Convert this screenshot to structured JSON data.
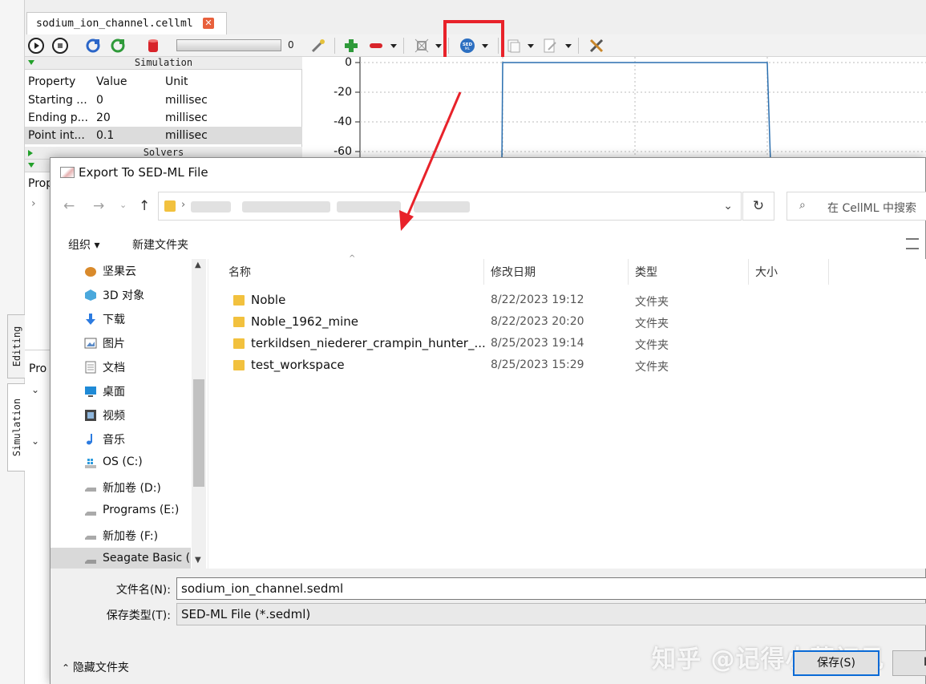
{
  "app": {
    "file_tab": "sodium_ion_channel.cellml",
    "file_tab_close": "✕",
    "side_tabs": [
      "Editing",
      "Simulation"
    ],
    "progress_value": "0",
    "sedml_icon_text": "SED ML",
    "simulation_header": "Simulation",
    "solvers_header": "Solvers",
    "property_table": {
      "headers": [
        "Property",
        "Value",
        "Unit"
      ],
      "rows": [
        [
          "Starting ...",
          "0",
          "millisec"
        ],
        [
          "Ending p...",
          "20",
          "millisec"
        ],
        [
          "Point int...",
          "0.1",
          "millisec"
        ]
      ]
    },
    "partial_labels": [
      "Prop",
      "Pro"
    ],
    "graph_ticks": [
      "0",
      "-20",
      "-40",
      "-60"
    ]
  },
  "dialog": {
    "title": "Export To SED-ML File",
    "search_placeholder": "在 CellML 中搜索",
    "organize": "组织 ▾",
    "new_folder": "新建文件夹",
    "nav_items": [
      {
        "label": "坚果云",
        "icon": "nut-cloud-icon"
      },
      {
        "label": "3D 对象",
        "icon": "3d-objects-icon"
      },
      {
        "label": "下载",
        "icon": "download-icon"
      },
      {
        "label": "图片",
        "icon": "pictures-icon"
      },
      {
        "label": "文档",
        "icon": "documents-icon"
      },
      {
        "label": "桌面",
        "icon": "desktop-icon"
      },
      {
        "label": "视频",
        "icon": "videos-icon"
      },
      {
        "label": "音乐",
        "icon": "music-icon"
      },
      {
        "label": "OS (C:)",
        "icon": "windows-drive-icon"
      },
      {
        "label": "新加卷 (D:)",
        "icon": "drive-icon"
      },
      {
        "label": "Programs (E:)",
        "icon": "drive-icon"
      },
      {
        "label": "新加卷 (F:)",
        "icon": "drive-icon"
      },
      {
        "label": "Seagate Basic (",
        "icon": "drive-icon"
      }
    ],
    "columns": [
      "名称",
      "修改日期",
      "类型",
      "大小"
    ],
    "files": [
      {
        "name": "Noble",
        "date": "8/22/2023 19:12",
        "type": "文件夹"
      },
      {
        "name": "Noble_1962_mine",
        "date": "8/22/2023 20:20",
        "type": "文件夹"
      },
      {
        "name": "terkildsen_niederer_crampin_hunter_...",
        "date": "8/25/2023 19:14",
        "type": "文件夹"
      },
      {
        "name": "test_workspace",
        "date": "8/25/2023 15:29",
        "type": "文件夹"
      }
    ],
    "filename_label": "文件名(N):",
    "filename_value": "sodium_ion_channel.sedml",
    "filetype_label": "保存类型(T):",
    "filetype_value": "SED-ML File (*.sedml)",
    "hide_folders": "隐藏文件夹",
    "save_button": "保存(S)",
    "cancel_partial": "I",
    "watermark": "知乎 @记得小蘋初见"
  }
}
